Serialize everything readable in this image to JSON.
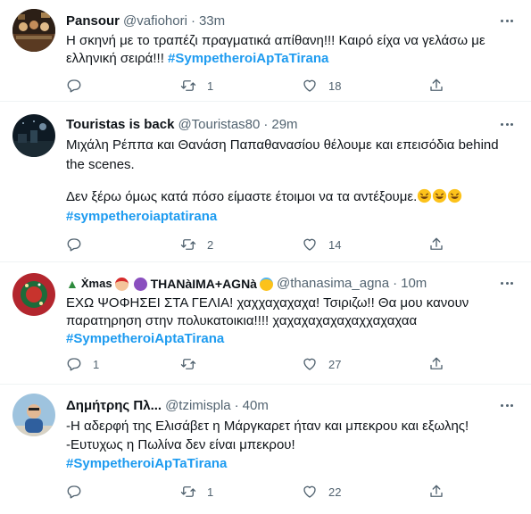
{
  "tweets": [
    {
      "name": "Pansour",
      "handle": "@vafiohori",
      "separator": "·",
      "time": "33m",
      "lines": [
        "Η σκηνή με το τραπέζι πραγματικά απίθανη!!! Καιρό είχα να γελάσω με",
        "ελληνική σειρά!!! "
      ],
      "hashtag": "#SympetheroiApTaTirana",
      "replies": "",
      "retweets": "1",
      "likes": "18"
    },
    {
      "name": "Touristas is back",
      "handle": "@Touristas80",
      "separator": "·",
      "time": "29m",
      "lines": [
        "Μιχάλη Ρέππα και Θανάση Παπαθανασίου θέλουμε και επεισόδια behind",
        "the scenes.",
        "",
        "Δεν ξέρω όμως κατά πόσο είμαστε έτοιμοι να τα αντέξουμε."
      ],
      "hashtag": "#sympetheroiaptatirana",
      "replies": "",
      "retweets": "2",
      "likes": "14"
    },
    {
      "name": "Xmas THANàIMA+AGNà",
      "name_part1": "Ẋmas",
      "name_part2": "THANàIMA+AGNà",
      "handle": "@thanasima_agna",
      "separator": "·",
      "time": "10m",
      "lines": [
        "ΕΧΩ ΨΟΦΗΣΕΙ ΣΤΑ ΓΕΛΙΑ! χαχχαχαχαχα! Τσιριζω!! Θα μου κανουν",
        "παρατηρηση στην πολυκατοικια!!!! χαχαχαχαχαχαχχαχαχαα"
      ],
      "hashtag": "#SympetheroiAptaTirana",
      "replies": "1",
      "retweets": "",
      "likes": "27"
    },
    {
      "name": "Δημήτρης Πλ...",
      "handle": "@tzimispla",
      "separator": "·",
      "time": "40m",
      "lines": [
        "-Η αδερφή της Ελισάβετ η Μάργκαρετ ήταν και μπεκρου και εξωλης!",
        "-Ευτυχως η Πωλίνα δεν είναι μπεκρου!"
      ],
      "hashtag": "#SympetheroiApTaTirana",
      "replies": "",
      "retweets": "1",
      "likes": "22"
    }
  ],
  "colors": {
    "text": "#0f1419",
    "secondary": "#536471",
    "link": "#1d9bf0",
    "divider": "#eff3f4"
  },
  "icons": [
    "reply-icon",
    "retweet-icon",
    "like-icon",
    "share-icon",
    "more-icon"
  ]
}
